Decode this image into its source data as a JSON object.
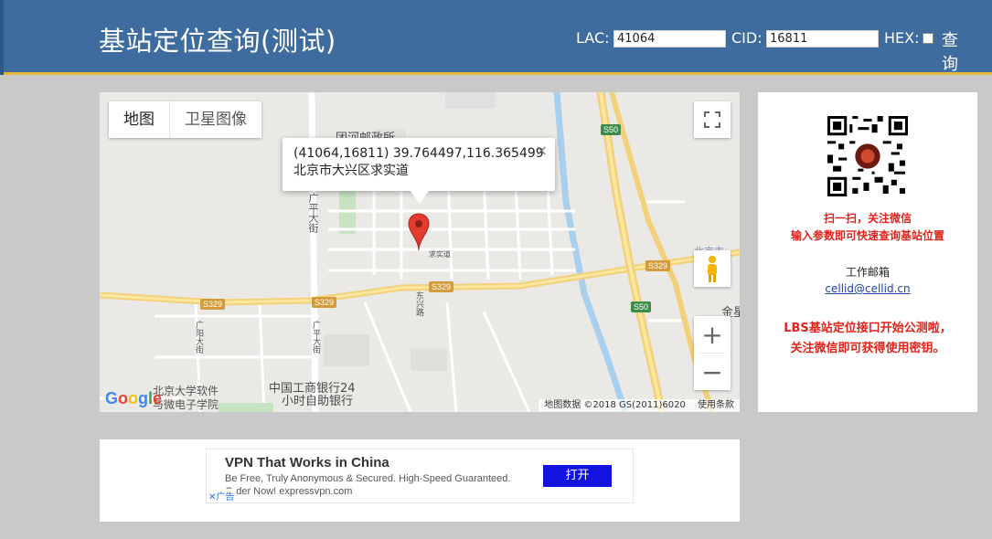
{
  "header": {
    "title": "基站定位查询(测试)",
    "lac_label": "LAC:",
    "lac_value": "41064",
    "cid_label": "CID:",
    "cid_value": "16811",
    "hex_label": "HEX:",
    "query_label": "查 询"
  },
  "map": {
    "type_tabs": [
      {
        "label": "地图",
        "active": true
      },
      {
        "label": "卫星图像",
        "active": false
      }
    ],
    "info": {
      "line1": "(41064,16811) 39.764497,116.365499",
      "line2": "北京市大兴区求实道",
      "close": "×"
    },
    "labels": {
      "post_office": "团河邮政所",
      "guangping": "广平大街",
      "guangping2": "广平大街",
      "guangyang": "广阳大街",
      "icbc1": "中国工商银行24",
      "icbc2": "小时自助银行",
      "pku1": "北京大学软件",
      "pku2": "与微电子学院",
      "dongxing": "东兴路",
      "jinxing": "金星",
      "beijing": "北京市",
      "qiushi": "求实道"
    },
    "shields": [
      "S329",
      "S329",
      "S329",
      "S329",
      "S50",
      "S50"
    ],
    "logo": "Google",
    "attribution": "地图数据 ©2018 GS(2011)6020",
    "terms": "使用条款",
    "zoom_in": "+",
    "zoom_out": "−"
  },
  "side": {
    "scan_text": "扫一扫，关注微信",
    "scan_text2": "输入参数即可快速查询基站位置",
    "email_label": "工作邮箱",
    "email": "cellid@cellid.cn",
    "notice1": "LBS基站定位接口开始公测啦，",
    "notice2": "关注微信即可获得使用密钥。"
  },
  "ad": {
    "title": "VPN That Works in China",
    "desc": "Be Free, Truly Anonymous & Secured. High-Speed Guaranteed.",
    "url": "Order Now! expressvpn.com",
    "button": "打开",
    "badge": "✕广告"
  },
  "colors": {
    "header_bg": "#3f6c9e",
    "header_border": "#e3b73a",
    "accent_red": "#e0241b",
    "link_blue": "#1a3fa8",
    "ad_button": "#1313e0"
  }
}
